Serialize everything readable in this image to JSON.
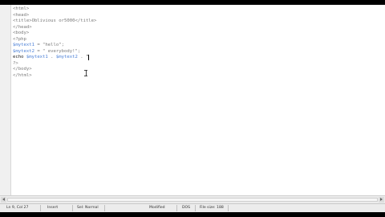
{
  "editor": {
    "lines": [
      {
        "parts": [
          {
            "t": "<html>",
            "c": "tag"
          }
        ]
      },
      {
        "parts": [
          {
            "t": "<head>",
            "c": "tag"
          }
        ]
      },
      {
        "parts": [
          {
            "t": "<title>Oblivious",
            "c": "tag"
          },
          {
            "t": " ",
            "c": "tag"
          },
          {
            "t": "or5000</title>",
            "c": "tag"
          }
        ]
      },
      {
        "parts": [
          {
            "t": "</head>",
            "c": "tag"
          }
        ]
      },
      {
        "parts": [
          {
            "t": "<body>",
            "c": "tag"
          }
        ]
      },
      {
        "parts": [
          {
            "t": "<?php",
            "c": "tag"
          }
        ]
      },
      {
        "parts": [
          {
            "t": "$mytext1",
            "c": "var"
          },
          {
            "t": " = \"hello\";",
            "c": "str"
          }
        ]
      },
      {
        "parts": [
          {
            "t": "$mytext2",
            "c": "var"
          },
          {
            "t": " = \" everybody!\";",
            "c": "str"
          }
        ]
      },
      {
        "parts": [
          {
            "t": "echo ",
            "c": "kw"
          },
          {
            "t": "$mytext1",
            "c": "var"
          },
          {
            "t": " . ",
            "c": "str"
          },
          {
            "t": "$mytext2",
            "c": "var"
          },
          {
            "t": " . ",
            "c": "str"
          },
          {
            "t": "\"",
            "c": "kw"
          }
        ]
      },
      {
        "parts": [
          {
            "t": "?>",
            "c": "tag"
          }
        ]
      },
      {
        "parts": [
          {
            "t": "</body>",
            "c": "tag"
          }
        ]
      },
      {
        "parts": [
          {
            "t": "</html>",
            "c": "tag"
          }
        ]
      }
    ]
  },
  "status": {
    "position": "Ln 9, Col 27",
    "mode": "Insert",
    "style": "Sel: Normal",
    "modified": "Modified",
    "encoding": "DOS",
    "filesize": "File size: 188"
  }
}
